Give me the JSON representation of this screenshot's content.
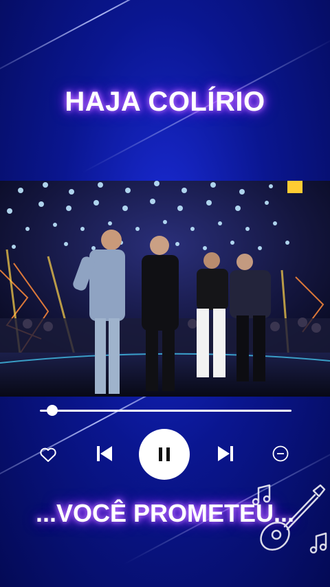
{
  "header": {
    "title": "HAJA COLÍRIO"
  },
  "video": {
    "description_icon": "music-video-frame"
  },
  "player": {
    "progress": 0.05,
    "buttons": {
      "like": "heart-icon",
      "previous": "skip-previous-icon",
      "play_pause": "pause-icon",
      "next": "skip-next-icon",
      "remove": "minus-circle-icon"
    },
    "colors": {
      "accent": "#ffffff",
      "glow": "#9b3dff",
      "background": "#0a1690"
    }
  },
  "lyrics": {
    "line": "...VOCÊ PROMETEU..."
  }
}
